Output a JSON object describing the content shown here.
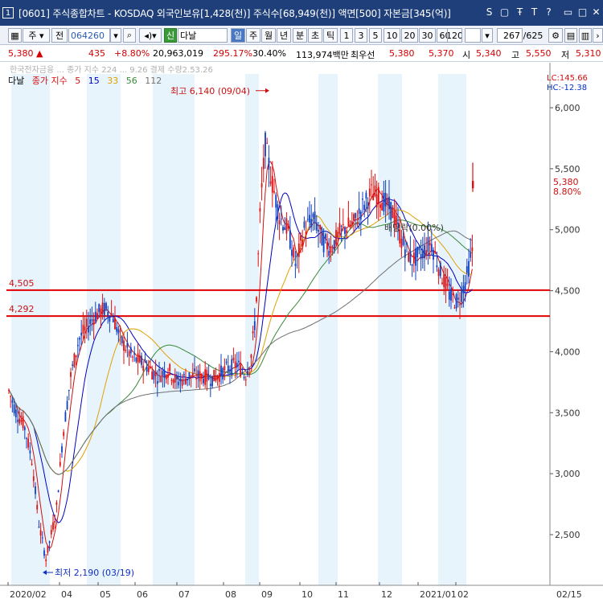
{
  "window": {
    "screen_num": "1",
    "title": "[0601] 주식종합차트 - KOSDAQ 외국인보유[1,428(천)] 주식수[68,949(천)] 액면[500] 자본금[345(억)]",
    "controls": [
      "S",
      "▢",
      "Ŧ",
      "T",
      "?",
      "▭",
      "□",
      "✕"
    ]
  },
  "toolbar": {
    "market": "주",
    "prev_label": "전",
    "code": "064260",
    "badge": "신",
    "stock_name": "다날",
    "periods": [
      "일",
      "주",
      "월",
      "년",
      "분",
      "초",
      "틱"
    ],
    "active_period": "일",
    "intervals": [
      "1",
      "3",
      "5",
      "10",
      "20",
      "30",
      "60",
      "120"
    ],
    "count": "267",
    "total": "/625"
  },
  "quote": {
    "price": "5,380",
    "arrow": "▲",
    "change": "435",
    "change_pct": "+8.80%",
    "volume": "20,963,019",
    "volume_ratio": "295.17%",
    "turnover": "30.40%",
    "amount": "113,974백만",
    "best_label": "최우선",
    "ask": "5,380",
    "bid": "5,370",
    "open_label": "시",
    "open": "5,340",
    "high_label": "고",
    "high": "5,550",
    "low_label": "저",
    "low": "5,310"
  },
  "ticker_text": "한국전자금융 ... 종가 지수 224 ... 9.26 결제 수량2.53.26",
  "chart_meta": {
    "stock_label": "다날",
    "ma_label": "종가 지수",
    "ma_periods": [
      "5",
      "15",
      "33",
      "56",
      "112"
    ],
    "ma_colors": [
      "#d01010",
      "#0000c0",
      "#e0a000",
      "#3a8a3a",
      "#707070"
    ],
    "lc": "LC:145.66",
    "hc": "HC:-12.38",
    "high_note": "최고 6,140 (09/04)",
    "low_note": "최저 2,190 (03/19)",
    "dividend_note": "배당락(0.00%)",
    "hline1": "4,505",
    "hline2": "4,292",
    "current_price": "5,380",
    "current_pct": "8.80%"
  },
  "chart_data": {
    "type": "candlestick",
    "y_ticks": [
      "6,000",
      "5,500",
      "5,000",
      "4,500",
      "4,000",
      "3,500",
      "3,000",
      "2,500"
    ],
    "x_ticks": [
      "2020/02",
      "04",
      "05",
      "06",
      "07",
      "08",
      "09",
      "10",
      "11",
      "12",
      "2021/01",
      "02"
    ],
    "right_x_label": "02/15",
    "ylim": [
      2150,
      6250
    ],
    "x_months": [
      "2020-02",
      "2020-03",
      "2020-04",
      "2020-05",
      "2020-06",
      "2020-07",
      "2020-08",
      "2020-09",
      "2020-10",
      "2020-11",
      "2020-12",
      "2021-01",
      "2021-02"
    ],
    "approx_close_by_month": [
      3550,
      2600,
      3900,
      4200,
      3900,
      3800,
      3950,
      5600,
      5000,
      5100,
      5200,
      4700,
      5380
    ],
    "horizontal_lines": [
      4505,
      4292
    ],
    "high_point": {
      "date": "09/04",
      "value": 6140
    },
    "low_point": {
      "date": "03/19",
      "value": 2190
    }
  }
}
